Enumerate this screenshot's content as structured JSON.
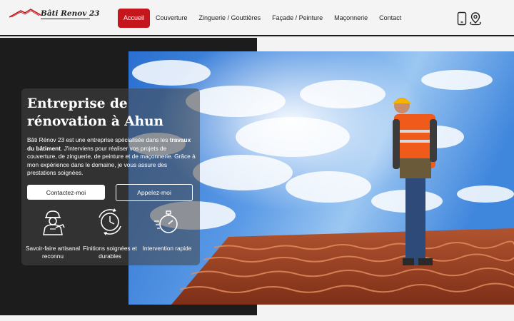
{
  "brand": {
    "name": "Bâti Renov 23"
  },
  "nav": {
    "items": [
      {
        "label": "Accueil",
        "active": true
      },
      {
        "label": "Couverture"
      },
      {
        "label": "Zinguerie / Gouttières"
      },
      {
        "label": "Façade / Peinture"
      },
      {
        "label": "Maçonnerie"
      },
      {
        "label": "Contact"
      }
    ],
    "icons": [
      "phone-icon",
      "location-pin-icon"
    ]
  },
  "hero": {
    "title_line1": "Entreprise de",
    "title_line2": "rénovation à Ahun",
    "desc_before": "Bâti Rénov 23 est une entreprise spécialisée dans les ",
    "desc_bold": "travaux du bâtiment",
    "desc_after": ". J'interviens pour réaliser vos projets de couverture, de zinguerie, de peinture et de maçonnerie. Grâce à mon expérience dans le domaine, je vous assure des prestations soignées.",
    "btn_contact": "Contactez-moi",
    "btn_call": "Appelez-moi",
    "features": [
      {
        "icon": "worker-icon",
        "label": "Savoir-faire artisanal reconnu"
      },
      {
        "icon": "clock-icon",
        "label": "Finitions soignées et durables"
      },
      {
        "icon": "stopwatch-icon",
        "label": "Intervention rapide"
      }
    ]
  },
  "colors": {
    "accent": "#c4161c",
    "dark": "#1c1c1c",
    "nav_bg": "#f4f4f4"
  }
}
